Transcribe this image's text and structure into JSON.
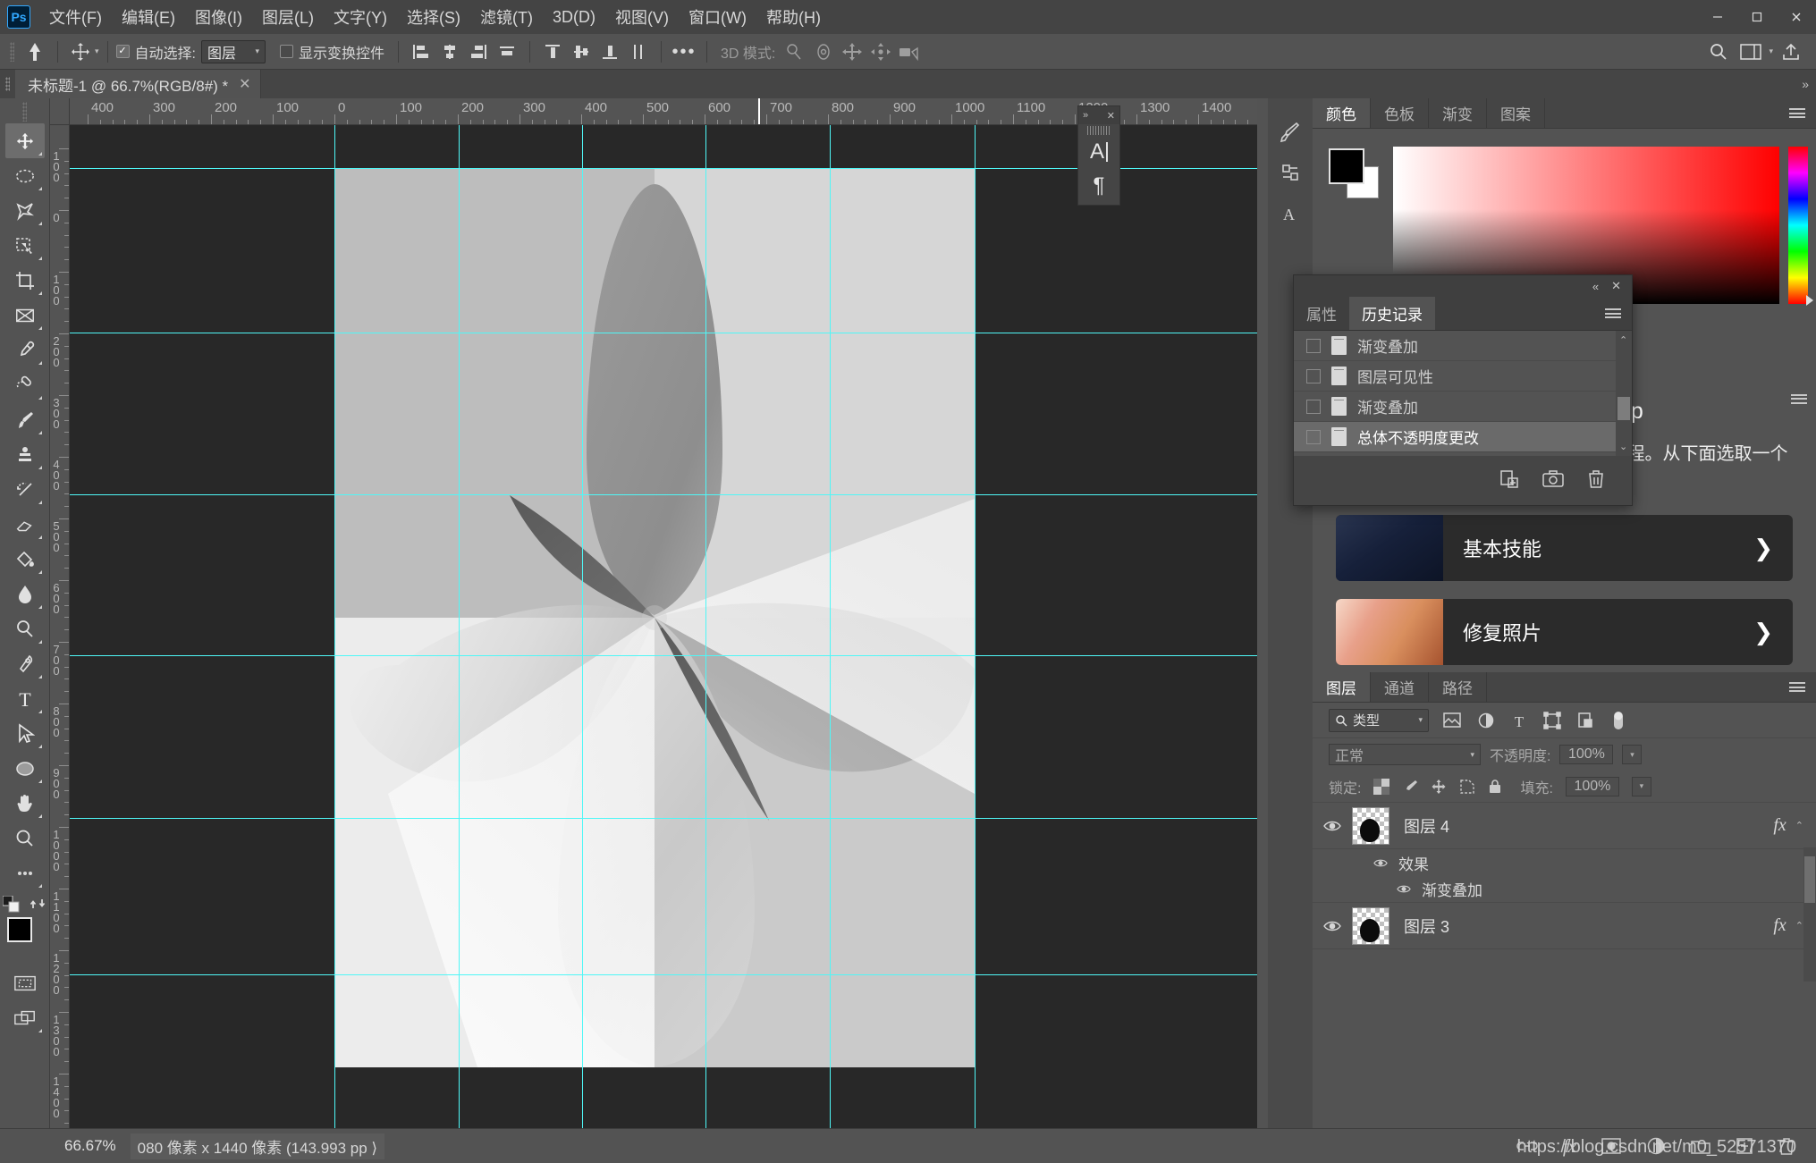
{
  "app": {
    "name": "Photoshop",
    "logo_text": "Ps"
  },
  "menubar": {
    "items": [
      {
        "label": "文件(F)"
      },
      {
        "label": "编辑(E)"
      },
      {
        "label": "图像(I)"
      },
      {
        "label": "图层(L)"
      },
      {
        "label": "文字(Y)"
      },
      {
        "label": "选择(S)"
      },
      {
        "label": "滤镜(T)"
      },
      {
        "label": "3D(D)"
      },
      {
        "label": "视图(V)"
      },
      {
        "label": "窗口(W)"
      },
      {
        "label": "帮助(H)"
      }
    ],
    "window_controls": {
      "minimize": "—",
      "maximize": "❐",
      "close": "✕"
    }
  },
  "optionsbar": {
    "auto_select_label": "自动选择:",
    "auto_select_checked": true,
    "auto_select_value": "图层",
    "show_transform_label": "显示变换控件",
    "show_transform_checked": false,
    "more_label": "•••",
    "mode_3d_label": "3D 模式:"
  },
  "tabbar": {
    "document_tab": "未标题-1 @ 66.7%(RGB/8#) *",
    "close_glyph": "✕"
  },
  "rulers": {
    "horizontal_labels": [
      "400",
      "300",
      "200",
      "100",
      "0",
      "100",
      "200",
      "300",
      "400",
      "500",
      "600",
      "700",
      "800",
      "900",
      "1000",
      "1100",
      "1200",
      "1300",
      "1400"
    ],
    "vertical_labels": [
      "100",
      "0",
      "100",
      "200",
      "300",
      "400",
      "500",
      "600",
      "700",
      "800",
      "900",
      "1000",
      "1100",
      "1200",
      "1300",
      "1400"
    ],
    "unit": "像素"
  },
  "color_panel": {
    "tabs": [
      {
        "label": "颜色",
        "active": true
      },
      {
        "label": "色板",
        "active": false
      },
      {
        "label": "渐变",
        "active": false
      },
      {
        "label": "图案",
        "active": false
      }
    ],
    "foreground_color": "#000000",
    "background_color": "#ffffff",
    "ramp_start": "#ffffff",
    "ramp_end": "#ff0000"
  },
  "history_panel": {
    "collapse_glyph": "«",
    "close_glyph": "✕",
    "tabs": [
      {
        "label": "属性",
        "active": false
      },
      {
        "label": "历史记录",
        "active": true
      }
    ],
    "items": [
      {
        "label": "渐变叠加",
        "selected": false
      },
      {
        "label": "图层可见性",
        "selected": false
      },
      {
        "label": "渐变叠加",
        "selected": false
      },
      {
        "label": "总体不透明度更改",
        "selected": true
      }
    ],
    "footer_icons": [
      "new-document-from-state-icon",
      "new-snapshot-icon",
      "delete-icon"
    ]
  },
  "learn_panel": {
    "title": "了解 Photoshop",
    "description": "在应用程序内直接提供的分步指导教程。从下面选取一个主题开始教程。",
    "cards": [
      {
        "label": "基本技能",
        "arrow": "❯"
      },
      {
        "label": "修复照片",
        "arrow": "❯"
      }
    ]
  },
  "layers_panel": {
    "tabs": [
      {
        "label": "图层",
        "active": true
      },
      {
        "label": "通道",
        "active": false
      },
      {
        "label": "路径",
        "active": false
      }
    ],
    "filter_label": "类型",
    "blend_mode": "正常",
    "opacity_label": "不透明度:",
    "opacity_value": "100%",
    "lock_label": "锁定:",
    "fill_label": "填充:",
    "fill_value": "100%",
    "layers": [
      {
        "name": "图层 4",
        "visible": true,
        "has_fx": true,
        "effects_label": "效果",
        "effects": [
          "渐变叠加"
        ]
      },
      {
        "name": "图层 3",
        "visible": true,
        "has_fx": true,
        "effects_label": "",
        "effects": []
      }
    ]
  },
  "char_panel": {
    "collapse_glyph": "»",
    "close_glyph": "✕",
    "items": [
      "A",
      "¶"
    ]
  },
  "statusbar": {
    "zoom": "66.67%",
    "dimensions": "080 像素 x 1440 像素 (143.993 pp ⟩"
  },
  "watermark": {
    "text": "https://blog.csdn.net/m0_52571370"
  },
  "colors": {
    "app_bg": "#535353",
    "menu_bg": "#444444",
    "panel_bg": "#535353",
    "tab_bg": "#454545",
    "canvas_bg": "#282828",
    "guide": "#4ff7f7",
    "accent": "#31a8ff"
  },
  "tools": [
    {
      "name": "move-tool",
      "active": true
    },
    {
      "name": "marquee-tool",
      "active": false
    },
    {
      "name": "lasso-tool",
      "active": false
    },
    {
      "name": "quick-selection-tool",
      "active": false
    },
    {
      "name": "crop-tool",
      "active": false
    },
    {
      "name": "frame-tool",
      "active": false
    },
    {
      "name": "eyedropper-tool",
      "active": false
    },
    {
      "name": "healing-brush-tool",
      "active": false
    },
    {
      "name": "brush-tool",
      "active": false
    },
    {
      "name": "clone-stamp-tool",
      "active": false
    },
    {
      "name": "history-brush-tool",
      "active": false
    },
    {
      "name": "eraser-tool",
      "active": false
    },
    {
      "name": "paint-bucket-tool",
      "active": false
    },
    {
      "name": "blur-tool",
      "active": false
    },
    {
      "name": "dodge-tool",
      "active": false
    },
    {
      "name": "pen-tool",
      "active": false
    },
    {
      "name": "type-tool",
      "active": false
    },
    {
      "name": "path-selection-tool",
      "active": false
    },
    {
      "name": "shape-tool",
      "active": false
    },
    {
      "name": "hand-tool",
      "active": false
    },
    {
      "name": "zoom-tool",
      "active": false
    },
    {
      "name": "more-tools",
      "active": false
    }
  ]
}
